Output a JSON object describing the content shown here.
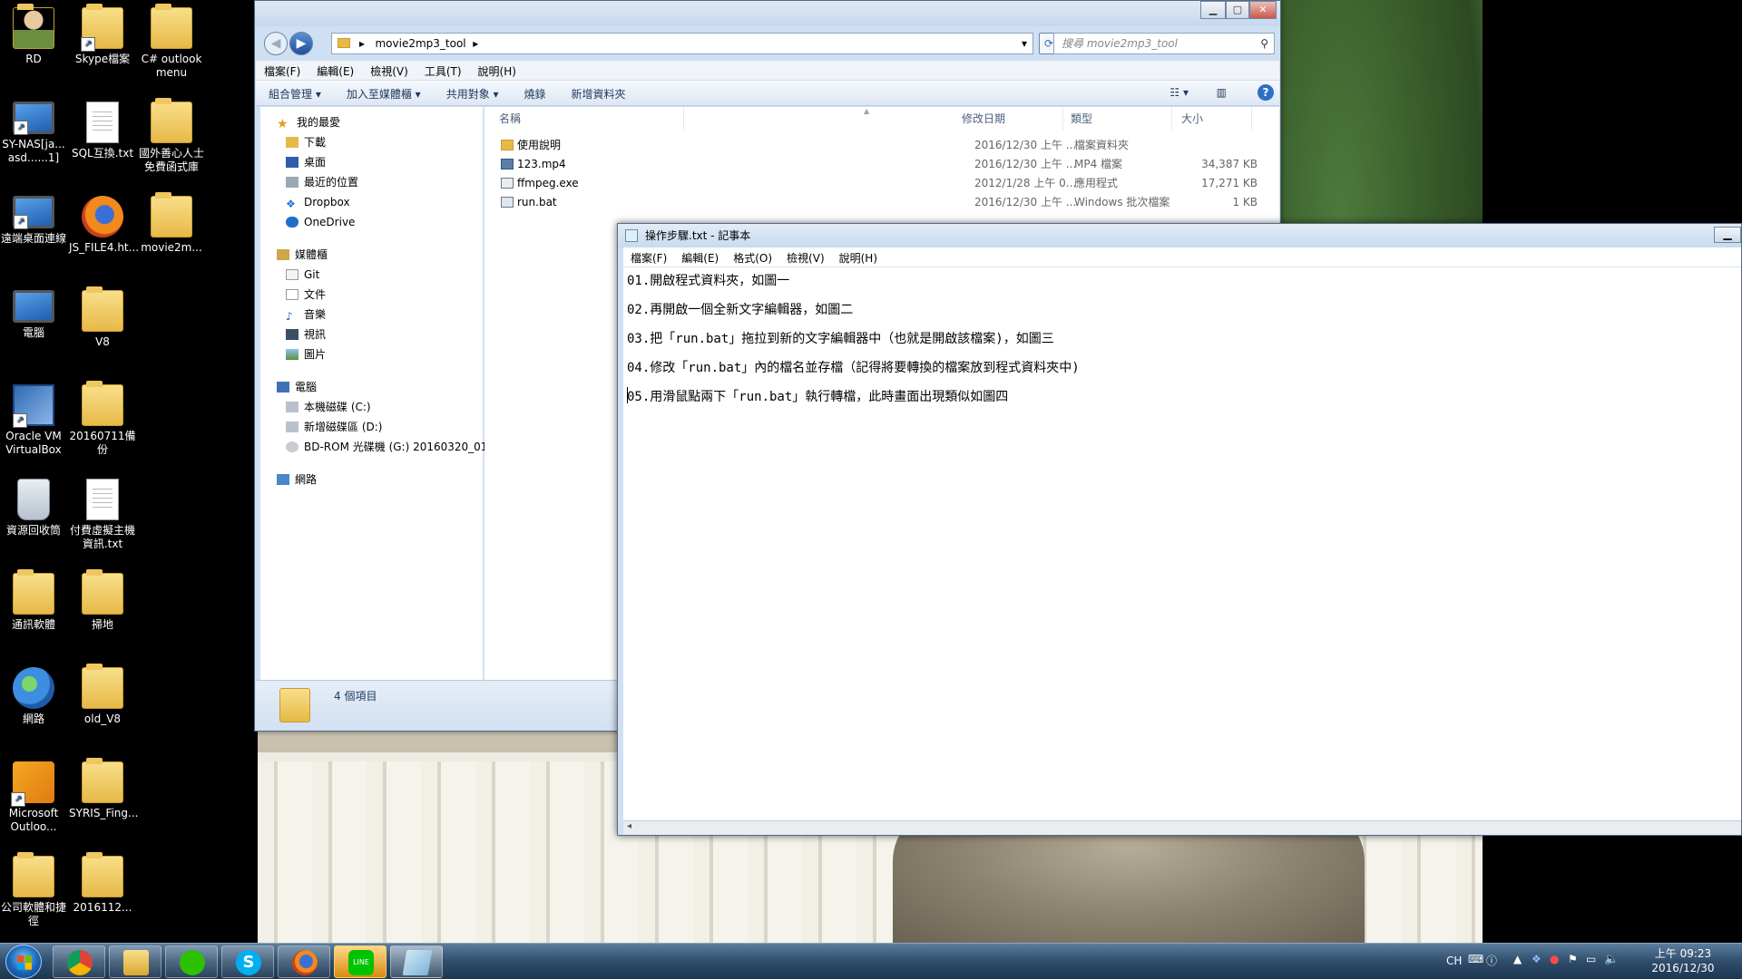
{
  "desktop": {
    "icons": [
      {
        "label": "RD"
      },
      {
        "label": "Skype檔案"
      },
      {
        "label": "C# outlook menu"
      },
      {
        "label": "SY-NAS[ja... asd......1]"
      },
      {
        "label": "SQL互換.txt"
      },
      {
        "label": "國外善心人士免費函式庫"
      },
      {
        "label": "遠端桌面連線"
      },
      {
        "label": "JS_FILE4.ht..."
      },
      {
        "label": "movie2m..."
      },
      {
        "label": "電腦"
      },
      {
        "label": "V8"
      },
      {
        "label": "Oracle VM VirtualBox"
      },
      {
        "label": "20160711備份"
      },
      {
        "label": "資源回收筒"
      },
      {
        "label": "付費虛擬主機資訊.txt"
      },
      {
        "label": "通訊軟體"
      },
      {
        "label": "掃地"
      },
      {
        "label": "網路"
      },
      {
        "label": "old_V8"
      },
      {
        "label": "Microsoft Outloo..."
      },
      {
        "label": "SYRIS_Fing..."
      },
      {
        "label": "公司軟體和捷徑"
      },
      {
        "label": "2016112..."
      }
    ]
  },
  "explorer": {
    "address": "movie2mp3_tool",
    "search_placeholder": "搜尋 movie2mp3_tool",
    "menu": [
      "檔案(F)",
      "編輯(E)",
      "檢視(V)",
      "工具(T)",
      "說明(H)"
    ],
    "toolbar": [
      "組合管理 ▾",
      "加入至媒體櫃 ▾",
      "共用對象 ▾",
      "燒錄",
      "新增資料夾"
    ],
    "nav": {
      "favorites_header": "我的最愛",
      "favorites": [
        "下載",
        "桌面",
        "最近的位置",
        "Dropbox",
        "OneDrive"
      ],
      "libraries_header": "媒體櫃",
      "libraries": [
        "Git",
        "文件",
        "音樂",
        "視訊",
        "圖片"
      ],
      "computer_header": "電腦",
      "drives": [
        "本機磁碟 (C:)",
        "新增磁碟區 (D:)",
        "BD-ROM 光碟機 (G:) 20160320_01"
      ],
      "network_header": "網路"
    },
    "columns": {
      "name": "名稱",
      "date": "修改日期",
      "type": "類型",
      "size": "大小"
    },
    "files": [
      {
        "name": "使用說明",
        "date": "2016/12/30 上午 ...",
        "type": "檔案資料夾",
        "size": ""
      },
      {
        "name": "123.mp4",
        "date": "2016/12/30 上午 ...",
        "type": "MP4 檔案",
        "size": "34,387 KB"
      },
      {
        "name": "ffmpeg.exe",
        "date": "2012/1/28 上午 0...",
        "type": "應用程式",
        "size": "17,271 KB"
      },
      {
        "name": "run.bat",
        "date": "2016/12/30 上午 ...",
        "type": "Windows 批次檔案",
        "size": "1 KB"
      }
    ],
    "status": "4 個項目"
  },
  "notepad": {
    "title": "操作步驟.txt - 記事本",
    "menu": [
      "檔案(F)",
      "編輯(E)",
      "格式(O)",
      "檢視(V)",
      "說明(H)"
    ],
    "lines": [
      "01.開啟程式資料夾，如圖一",
      "02.再開啟一個全新文字編輯器，如圖二",
      "03.把「run.bat」拖拉到新的文字編輯器中（也就是開啟該檔案)，如圖三",
      "04.修改「run.bat」內的檔名並存檔（記得將要轉換的檔案放到程式資料夾中)",
      "05.用滑鼠點兩下「run.bat」執行轉檔，此時畫面出現類似如圖四"
    ]
  },
  "taskbar": {
    "tray_lang": "CH",
    "time": "上午 09:23",
    "date": "2016/12/30"
  }
}
